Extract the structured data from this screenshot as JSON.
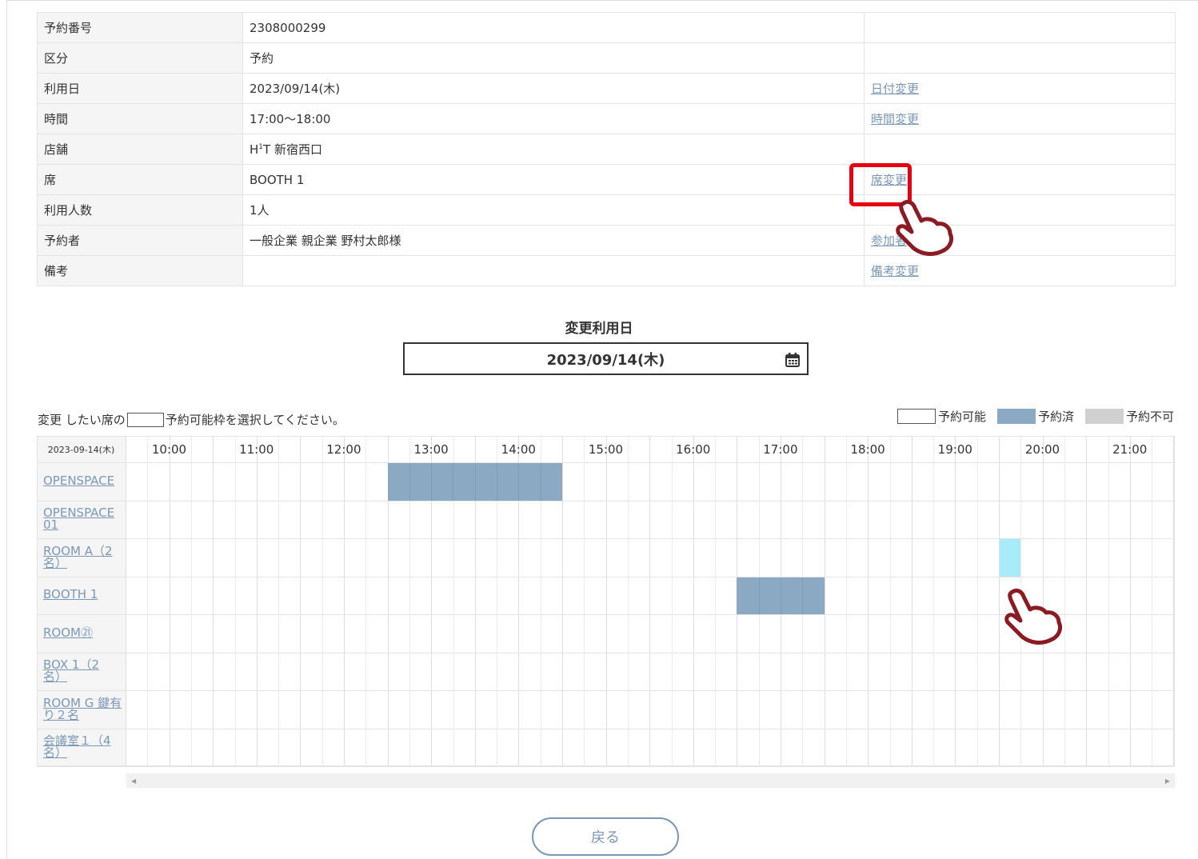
{
  "reservation": {
    "rows": [
      {
        "label": "予約番号",
        "value": "2308000299",
        "action": ""
      },
      {
        "label": "区分",
        "value": "予約",
        "action": ""
      },
      {
        "label": "利用日",
        "value": "2023/09/14(木)",
        "action": "日付変更"
      },
      {
        "label": "時間",
        "value": "17:00〜18:00",
        "action": "時間変更"
      },
      {
        "label": "店舗",
        "value_prefix": "H",
        "value_sup": "1",
        "value_suffix": "T 新宿西口",
        "action": ""
      },
      {
        "label": "席",
        "value": "BOOTH 1",
        "action": "席変更"
      },
      {
        "label": "利用人数",
        "value": "1人",
        "action": ""
      },
      {
        "label": "予約者",
        "value": "一般企業 親企業 野村太郎様",
        "action": "参加者"
      },
      {
        "label": "備考",
        "value": "",
        "action": "備考変更"
      }
    ]
  },
  "date_change": {
    "title": "変更利用日",
    "value": "2023/09/14(木)",
    "icon": "calendar-icon"
  },
  "instruction": {
    "prefix": "変更 したい席の",
    "suffix": "予約可能枠を選択してください。"
  },
  "legend": {
    "available": "予約可能",
    "booked": "予約済",
    "unavailable": "予約不可",
    "colors": {
      "available": "#ffffff",
      "booked": "#8ba9c3",
      "unavailable": "#d0d0d0",
      "selected": "#a8ecfa"
    }
  },
  "schedule": {
    "date": "2023-09-14(木)",
    "times": [
      "10:00",
      "11:00",
      "12:00",
      "13:00",
      "14:00",
      "15:00",
      "16:00",
      "17:00",
      "18:00",
      "19:00",
      "20:00",
      "21:00"
    ],
    "rooms": [
      {
        "line1": "OPENSPACE",
        "line2": ""
      },
      {
        "line1": "OPENSPACE",
        "line2": "01"
      },
      {
        "line1": "ROOM A（2",
        "line2": "名）"
      },
      {
        "line1": "BOOTH 1",
        "line2": ""
      },
      {
        "line1": "ROOM㉑",
        "line2": ""
      },
      {
        "line1": "BOX 1（2",
        "line2": "名）"
      },
      {
        "line1": "ROOM G 鍵有",
        "line2": "り２名"
      },
      {
        "line1": "会議室１（4",
        "line2": "名）"
      }
    ],
    "booked": [
      {
        "room": 0,
        "start": "13:00",
        "end": "15:00"
      },
      {
        "room": 3,
        "start": "17:00",
        "end": "18:00"
      }
    ],
    "selected": [
      {
        "room": 2,
        "start": "20:00",
        "end": "20:15"
      }
    ]
  },
  "footer": {
    "back_label": "戻る"
  }
}
